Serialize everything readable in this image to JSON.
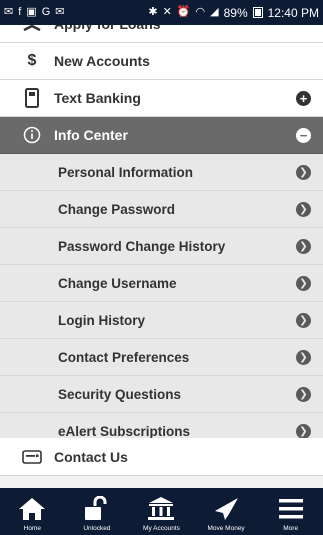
{
  "status_bar": {
    "battery": "89%",
    "time": "12:40 PM",
    "left_icons": [
      "mail-icon",
      "facebook-icon",
      "gallery-icon",
      "google-icon",
      "mail-icon"
    ],
    "right_icons": [
      "bluetooth-icon",
      "mute-icon",
      "alarm-icon",
      "wifi-icon",
      "signal-icon",
      "battery-icon"
    ]
  },
  "menu": {
    "items": [
      {
        "label": "Apply for Loans",
        "icon": "loan-icon"
      },
      {
        "label": "New Accounts",
        "icon": "dollar-icon"
      },
      {
        "label": "Text Banking",
        "icon": "phone-icon",
        "action": "expand-icon"
      }
    ],
    "active_section": {
      "label": "Info Center",
      "icon": "info-icon",
      "action": "collapse-icon",
      "subitems": [
        {
          "label": "Personal Information"
        },
        {
          "label": "Change Password"
        },
        {
          "label": "Password Change History"
        },
        {
          "label": "Change Username"
        },
        {
          "label": "Login History"
        },
        {
          "label": "Contact Preferences"
        },
        {
          "label": "Security Questions"
        },
        {
          "label": "eAlert Subscriptions"
        }
      ]
    },
    "footer_item": {
      "label": "Contact Us",
      "icon": "keyboard-icon"
    }
  },
  "tabbar": {
    "tabs": [
      {
        "label": "Home",
        "icon": "home-icon"
      },
      {
        "label": "Unlocked",
        "icon": "unlocked-icon"
      },
      {
        "label": "My Accounts",
        "icon": "bank-icon"
      },
      {
        "label": "Move Money",
        "icon": "send-icon"
      },
      {
        "label": "More",
        "icon": "menu-icon"
      }
    ]
  },
  "colors": {
    "nav_bg": "#0d1b34",
    "header_bg": "#6a6a6a",
    "sub_bg": "#e8e8e8",
    "text": "#333333"
  }
}
